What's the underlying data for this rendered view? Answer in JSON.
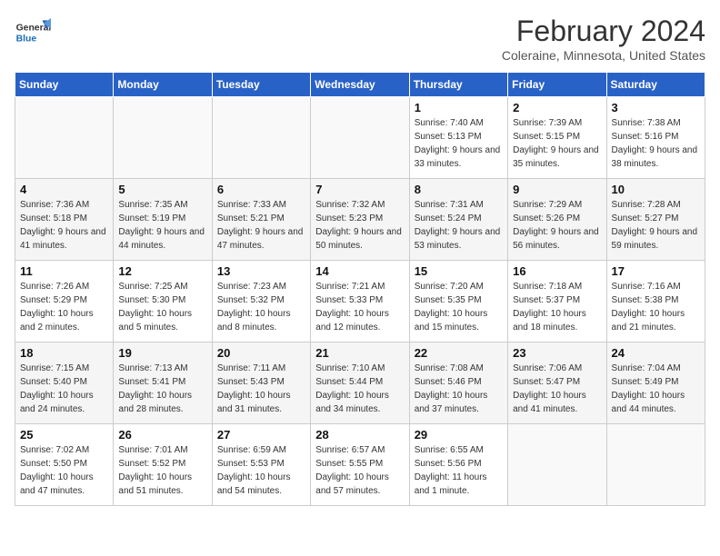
{
  "header": {
    "logo_general": "General",
    "logo_blue": "Blue",
    "month_title": "February 2024",
    "subtitle": "Coleraine, Minnesota, United States"
  },
  "days_of_week": [
    "Sunday",
    "Monday",
    "Tuesday",
    "Wednesday",
    "Thursday",
    "Friday",
    "Saturday"
  ],
  "weeks": [
    [
      {
        "day": "",
        "info": ""
      },
      {
        "day": "",
        "info": ""
      },
      {
        "day": "",
        "info": ""
      },
      {
        "day": "",
        "info": ""
      },
      {
        "day": "1",
        "info": "Sunrise: 7:40 AM\nSunset: 5:13 PM\nDaylight: 9 hours\nand 33 minutes."
      },
      {
        "day": "2",
        "info": "Sunrise: 7:39 AM\nSunset: 5:15 PM\nDaylight: 9 hours\nand 35 minutes."
      },
      {
        "day": "3",
        "info": "Sunrise: 7:38 AM\nSunset: 5:16 PM\nDaylight: 9 hours\nand 38 minutes."
      }
    ],
    [
      {
        "day": "4",
        "info": "Sunrise: 7:36 AM\nSunset: 5:18 PM\nDaylight: 9 hours\nand 41 minutes."
      },
      {
        "day": "5",
        "info": "Sunrise: 7:35 AM\nSunset: 5:19 PM\nDaylight: 9 hours\nand 44 minutes."
      },
      {
        "day": "6",
        "info": "Sunrise: 7:33 AM\nSunset: 5:21 PM\nDaylight: 9 hours\nand 47 minutes."
      },
      {
        "day": "7",
        "info": "Sunrise: 7:32 AM\nSunset: 5:23 PM\nDaylight: 9 hours\nand 50 minutes."
      },
      {
        "day": "8",
        "info": "Sunrise: 7:31 AM\nSunset: 5:24 PM\nDaylight: 9 hours\nand 53 minutes."
      },
      {
        "day": "9",
        "info": "Sunrise: 7:29 AM\nSunset: 5:26 PM\nDaylight: 9 hours\nand 56 minutes."
      },
      {
        "day": "10",
        "info": "Sunrise: 7:28 AM\nSunset: 5:27 PM\nDaylight: 9 hours\nand 59 minutes."
      }
    ],
    [
      {
        "day": "11",
        "info": "Sunrise: 7:26 AM\nSunset: 5:29 PM\nDaylight: 10 hours\nand 2 minutes."
      },
      {
        "day": "12",
        "info": "Sunrise: 7:25 AM\nSunset: 5:30 PM\nDaylight: 10 hours\nand 5 minutes."
      },
      {
        "day": "13",
        "info": "Sunrise: 7:23 AM\nSunset: 5:32 PM\nDaylight: 10 hours\nand 8 minutes."
      },
      {
        "day": "14",
        "info": "Sunrise: 7:21 AM\nSunset: 5:33 PM\nDaylight: 10 hours\nand 12 minutes."
      },
      {
        "day": "15",
        "info": "Sunrise: 7:20 AM\nSunset: 5:35 PM\nDaylight: 10 hours\nand 15 minutes."
      },
      {
        "day": "16",
        "info": "Sunrise: 7:18 AM\nSunset: 5:37 PM\nDaylight: 10 hours\nand 18 minutes."
      },
      {
        "day": "17",
        "info": "Sunrise: 7:16 AM\nSunset: 5:38 PM\nDaylight: 10 hours\nand 21 minutes."
      }
    ],
    [
      {
        "day": "18",
        "info": "Sunrise: 7:15 AM\nSunset: 5:40 PM\nDaylight: 10 hours\nand 24 minutes."
      },
      {
        "day": "19",
        "info": "Sunrise: 7:13 AM\nSunset: 5:41 PM\nDaylight: 10 hours\nand 28 minutes."
      },
      {
        "day": "20",
        "info": "Sunrise: 7:11 AM\nSunset: 5:43 PM\nDaylight: 10 hours\nand 31 minutes."
      },
      {
        "day": "21",
        "info": "Sunrise: 7:10 AM\nSunset: 5:44 PM\nDaylight: 10 hours\nand 34 minutes."
      },
      {
        "day": "22",
        "info": "Sunrise: 7:08 AM\nSunset: 5:46 PM\nDaylight: 10 hours\nand 37 minutes."
      },
      {
        "day": "23",
        "info": "Sunrise: 7:06 AM\nSunset: 5:47 PM\nDaylight: 10 hours\nand 41 minutes."
      },
      {
        "day": "24",
        "info": "Sunrise: 7:04 AM\nSunset: 5:49 PM\nDaylight: 10 hours\nand 44 minutes."
      }
    ],
    [
      {
        "day": "25",
        "info": "Sunrise: 7:02 AM\nSunset: 5:50 PM\nDaylight: 10 hours\nand 47 minutes."
      },
      {
        "day": "26",
        "info": "Sunrise: 7:01 AM\nSunset: 5:52 PM\nDaylight: 10 hours\nand 51 minutes."
      },
      {
        "day": "27",
        "info": "Sunrise: 6:59 AM\nSunset: 5:53 PM\nDaylight: 10 hours\nand 54 minutes."
      },
      {
        "day": "28",
        "info": "Sunrise: 6:57 AM\nSunset: 5:55 PM\nDaylight: 10 hours\nand 57 minutes."
      },
      {
        "day": "29",
        "info": "Sunrise: 6:55 AM\nSunset: 5:56 PM\nDaylight: 11 hours\nand 1 minute."
      },
      {
        "day": "",
        "info": ""
      },
      {
        "day": "",
        "info": ""
      }
    ]
  ]
}
